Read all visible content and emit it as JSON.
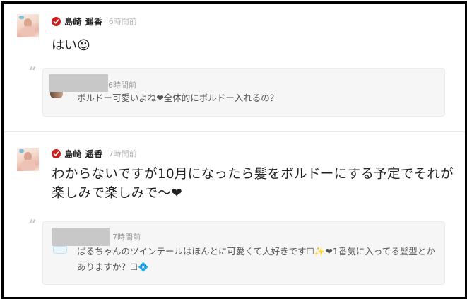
{
  "posts": [
    {
      "author": "島崎 遥香",
      "time": "6時間前",
      "body": "はい☺",
      "quote": {
        "time": "6時間前",
        "text": "ボルドー可愛いよね❤全体的にボルドー入れるの？"
      }
    },
    {
      "author": "島崎 遥香",
      "time": "7時間前",
      "body": "わからないですが10月になったら髪をボルドーにする予定でそれが楽しみで楽しみで〜❤",
      "quote": {
        "time": "7時間前",
        "text": "ぱるちゃんのツインテールはほんとに可愛くて大好きです☐✨❤1番気に入ってる髪型とかありますか？☐💠"
      }
    }
  ],
  "quote_glyph": "“",
  "colors": {
    "verified": "#cc1f1f",
    "timestamp": "#b5b5b5",
    "quote_bg": "#f6f6f6",
    "frame_border": "#000000"
  },
  "icons": {
    "verified": "verified-check-icon",
    "quote": "quote-mark-icon"
  }
}
